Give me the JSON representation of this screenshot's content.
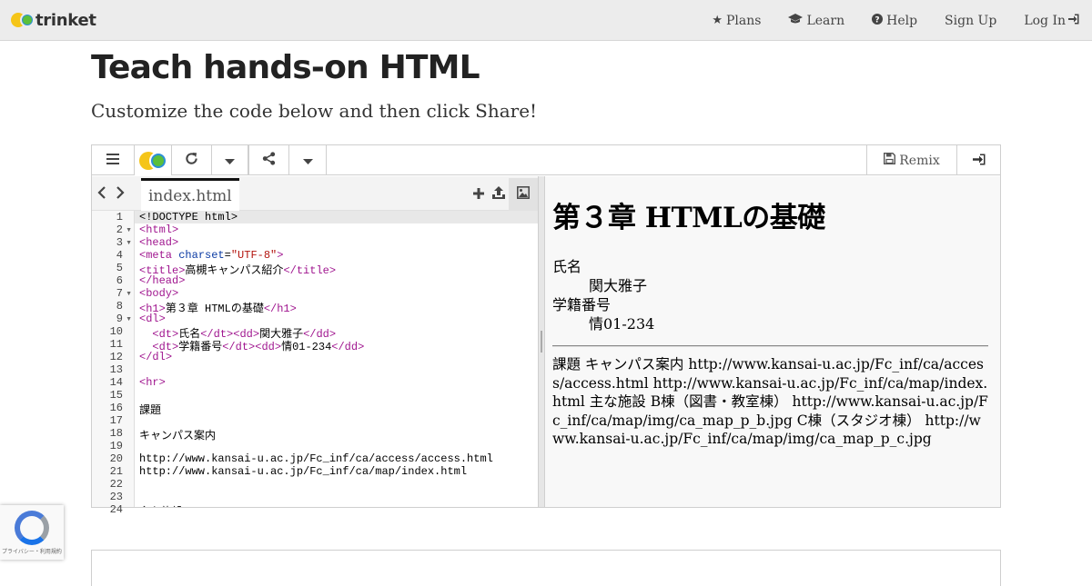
{
  "brand": {
    "name": "trinket"
  },
  "nav": {
    "plans": "Plans",
    "learn": "Learn",
    "help": "Help",
    "signup": "Sign Up",
    "login": "Log In"
  },
  "header": {
    "title": "Teach hands-on HTML",
    "subtitle": "Customize the code below and then click Share!"
  },
  "toolbar": {
    "remix_label": "Remix"
  },
  "editor": {
    "filename": "index.html",
    "line_numbers": [
      "1",
      "2",
      "3",
      "4",
      "5",
      "6",
      "7",
      "8",
      "9",
      "10",
      "11",
      "12",
      "13",
      "14",
      "15",
      "16",
      "17",
      "18",
      "19",
      "20",
      "21",
      "22",
      "23",
      "24"
    ],
    "lines": [
      "<!DOCTYPE html>",
      "<html>",
      "<head>",
      "<meta charset=\"UTF-8\">",
      "<title>高槻キャンパス紹介</title>",
      "</head>",
      "<body>",
      "<h1>第３章 HTMLの基礎</h1>",
      "<dl>",
      "  <dt>氏名</dt><dd>関大雅子</dd>",
      "  <dt>学籍番号</dt><dd>情01-234</dd>",
      "</dl>",
      "",
      "<hr>",
      "",
      "課題",
      "",
      "キャンパス案内",
      "",
      "http://www.kansai-u.ac.jp/Fc_inf/ca/access/access.html",
      "http://www.kansai-u.ac.jp/Fc_inf/ca/map/index.html",
      "",
      "",
      "主な施設"
    ]
  },
  "output": {
    "h1": "第３章 HTMLの基礎",
    "dt_name": "氏名",
    "dd_name": "関大雅子",
    "dt_id": "学籍番号",
    "dd_id": "情01-234",
    "body_text": "課題 キャンパス案内 http://www.kansai-u.ac.jp/Fc_inf/ca/access/access.html http://www.kansai-u.ac.jp/Fc_inf/ca/map/index.html 主な施設 B棟（図書・教室棟） http://www.kansai-u.ac.jp/Fc_inf/ca/map/img/ca_map_p_b.jpg C棟（スタジオ棟） http://www.kansai-u.ac.jp/Fc_inf/ca/map/img/ca_map_p_c.jpg"
  },
  "recaptcha": {
    "text": "プライバシー・利用規約"
  },
  "colors": {
    "tag": "#a0168f",
    "attr": "#0a3aa3",
    "string": "#b3150f",
    "navbar_bg": "#ececec"
  },
  "icons": [
    "star-icon",
    "graduation-cap-icon",
    "question-circle-icon",
    "sign-in-icon",
    "menu-icon",
    "refresh-icon",
    "caret-down-icon",
    "share-icon",
    "save-icon",
    "chevron-left-icon",
    "chevron-right-icon",
    "plus-icon",
    "upload-icon",
    "image-icon",
    "recaptcha-logo-icon"
  ]
}
